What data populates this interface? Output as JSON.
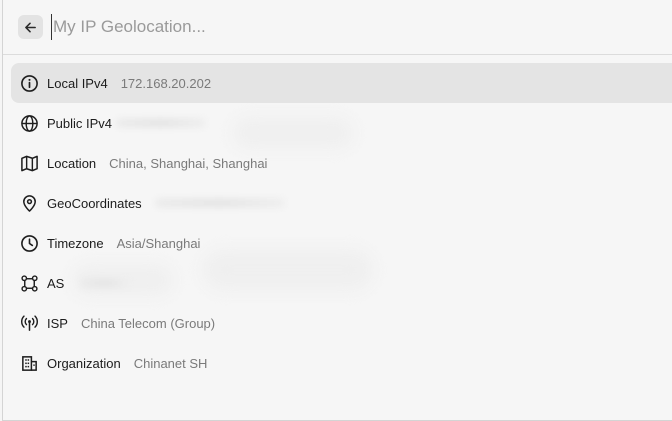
{
  "search": {
    "placeholder": "My IP Geolocation..."
  },
  "items": [
    {
      "label": "Local IPv4",
      "value": "172.168.20.202",
      "icon": "info-circle-icon",
      "selected": true
    },
    {
      "label": "Public IPv4",
      "value": "",
      "icon": "globe-icon",
      "selected": false
    },
    {
      "label": "Location",
      "value": "China, Shanghai, Shanghai",
      "icon": "map-icon",
      "selected": false
    },
    {
      "label": "GeoCoordinates",
      "value": "",
      "icon": "map-pin-icon",
      "selected": false
    },
    {
      "label": "Timezone",
      "value": "Asia/Shanghai",
      "icon": "clock-icon",
      "selected": false
    },
    {
      "label": "AS",
      "value": "",
      "icon": "network-nodes-icon",
      "selected": false
    },
    {
      "label": "ISP",
      "value": "China Telecom (Group)",
      "icon": "broadcast-antenna-icon",
      "selected": false
    },
    {
      "label": "Organization",
      "value": "Chinanet SH",
      "icon": "building-icon",
      "selected": false
    }
  ]
}
